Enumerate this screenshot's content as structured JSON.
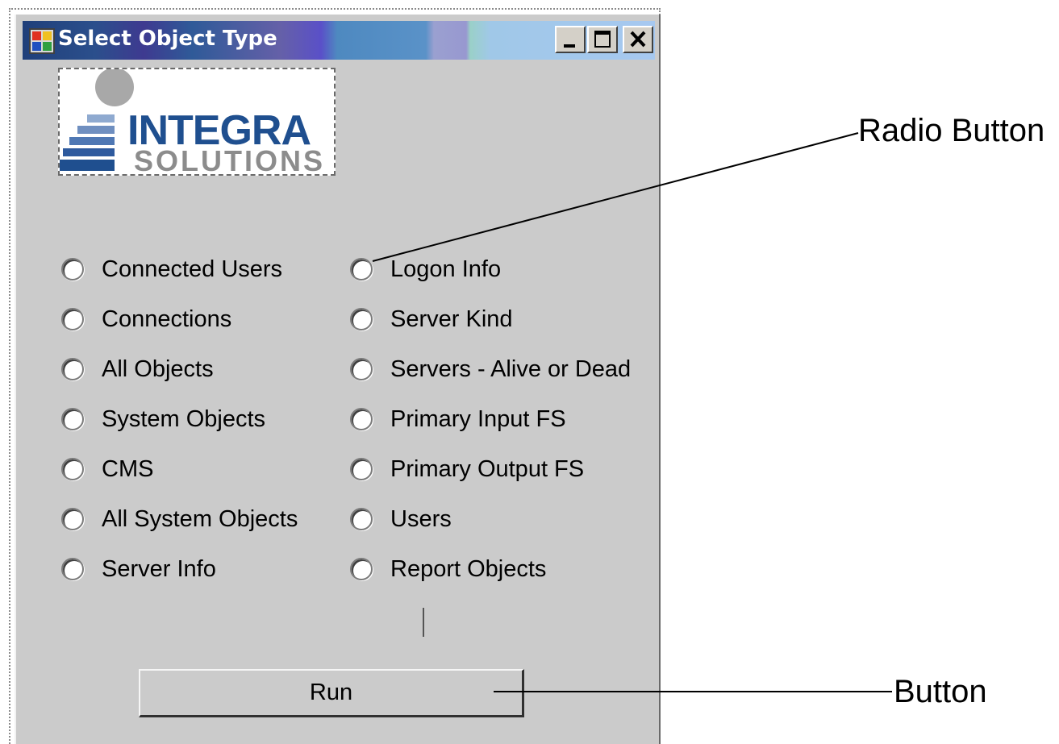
{
  "window": {
    "title": "Select Object Type",
    "controls": [
      "minimize",
      "maximize",
      "close"
    ]
  },
  "logo": {
    "line1": "INTEGRA",
    "line2": "SOLUTIONS"
  },
  "radios_left": [
    {
      "label": "Connected Users"
    },
    {
      "label": "Connections"
    },
    {
      "label": "All Objects"
    },
    {
      "label": "System Objects"
    },
    {
      "label": "CMS"
    },
    {
      "label": "All System Objects"
    },
    {
      "label": "Server Info"
    }
  ],
  "radios_right": [
    {
      "label": "Logon Info"
    },
    {
      "label": "Server Kind"
    },
    {
      "label": "Servers - Alive or Dead"
    },
    {
      "label": "Primary Input FS"
    },
    {
      "label": "Primary Output FS"
    },
    {
      "label": "Users"
    },
    {
      "label": "Report Objects"
    }
  ],
  "run_button": {
    "label": "Run"
  },
  "annotations": {
    "radio_button": "Radio Button",
    "button": "Button"
  },
  "colors": {
    "titlebar_start": "#1f3f7a",
    "titlebar_end": "#a6c8f0",
    "dialog_bg": "#cbcbcb"
  }
}
